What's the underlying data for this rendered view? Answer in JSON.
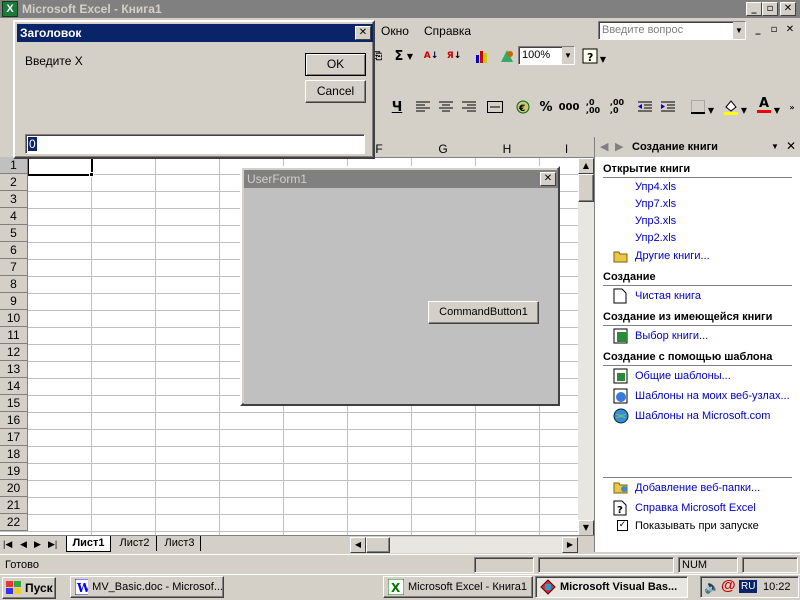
{
  "excel": {
    "title": "Microsoft Excel - Книга1",
    "menu": [
      "Окно",
      "Справка"
    ],
    "help_search": "Введите вопрос",
    "zoom": "100%",
    "columns": [
      "F",
      "G",
      "H",
      "I"
    ],
    "rows": [
      "1",
      "2",
      "3",
      "4",
      "5",
      "6",
      "7",
      "8",
      "9",
      "10",
      "11",
      "12",
      "13",
      "14",
      "15",
      "16",
      "17",
      "18",
      "19",
      "20",
      "21",
      "22"
    ],
    "sheets": [
      "Лист1",
      "Лист2",
      "Лист3"
    ],
    "status": "Готово",
    "num": "NUM"
  },
  "dialog": {
    "title": "Заголовок",
    "prompt": "Введите X",
    "ok": "OK",
    "cancel": "Cancel",
    "value": "0"
  },
  "userform": {
    "title": "UserForm1",
    "button": "CommandButton1"
  },
  "taskpane": {
    "title": "Создание книги",
    "open_heading": "Открытие книги",
    "files": [
      "Упр4.xls",
      "Упр7.xls",
      "Упр3.xls",
      "Упр2.xls"
    ],
    "other_books": "Другие книги...",
    "create_heading": "Создание",
    "blank_book": "Чистая книга",
    "from_existing_heading": "Создание из имеющейся книги",
    "choose_book": "Выбор книги...",
    "template_heading": "Создание с помощью шаблона",
    "general_templates": "Общие шаблоны...",
    "web_templates": "Шаблоны на моих веб-узлах...",
    "ms_templates": "Шаблоны на Microsoft.com",
    "add_web_folder": "Добавление веб-папки...",
    "help": "Справка Microsoft Excel",
    "show_on_start": "Показывать при запуске"
  },
  "taskbar": {
    "start": "Пуск",
    "tasks": [
      "MV_Basic.doc - Microsof...",
      "Microsoft Excel - Книга1",
      "Microsoft Visual Bas..."
    ],
    "lang": "RU",
    "clock": "10:22"
  }
}
